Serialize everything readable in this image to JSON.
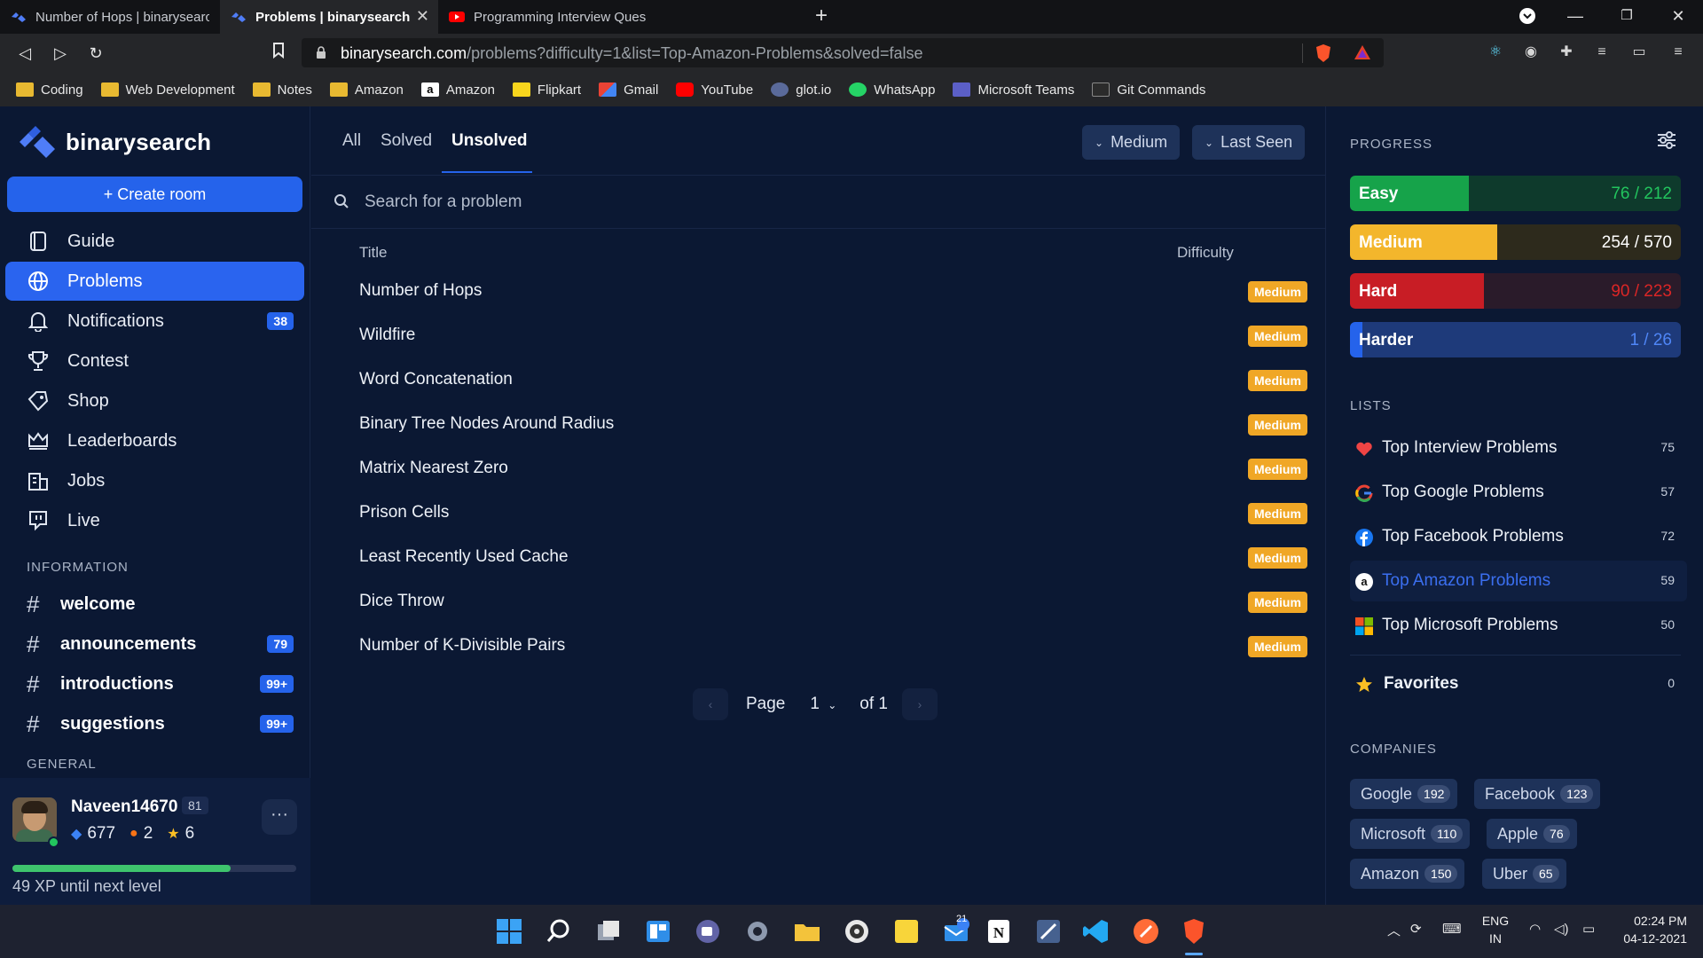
{
  "browser": {
    "tabs": [
      {
        "label": "Number of Hops | binarysearch",
        "active": false
      },
      {
        "label": "Problems | binarysearch",
        "active": true
      },
      {
        "label": "Programming Interview Question: Min",
        "active": false
      }
    ],
    "new_tab_label": "+",
    "url_domain": "binarysearch.com",
    "url_path": "/problems?difficulty=1&list=Top-Amazon-Problems&solved=false",
    "bookmarks": [
      {
        "label": "Coding",
        "icon": "folder-icon"
      },
      {
        "label": "Web Development",
        "icon": "folder-icon"
      },
      {
        "label": "Notes",
        "icon": "folder-icon"
      },
      {
        "label": "Amazon",
        "icon": "folder-icon"
      },
      {
        "label": "Amazon",
        "icon": "amazon-icon"
      },
      {
        "label": "Flipkart",
        "icon": "flipkart-icon"
      },
      {
        "label": "Gmail",
        "icon": "gmail-icon"
      },
      {
        "label": "YouTube",
        "icon": "youtube-icon"
      },
      {
        "label": "glot.io",
        "icon": "glot-icon"
      },
      {
        "label": "WhatsApp",
        "icon": "whatsapp-icon"
      },
      {
        "label": "Microsoft Teams",
        "icon": "teams-icon"
      },
      {
        "label": "Git Commands",
        "icon": "git-icon"
      }
    ]
  },
  "sidebar": {
    "logo_text": "binarysearch",
    "create_room": "+ Create room",
    "nav": [
      {
        "label": "Guide",
        "icon": "book-icon",
        "badge": ""
      },
      {
        "label": "Problems",
        "icon": "globe-icon",
        "badge": "",
        "active": true
      },
      {
        "label": "Notifications",
        "icon": "bell-icon",
        "badge": "38"
      },
      {
        "label": "Contest",
        "icon": "trophy-icon",
        "badge": ""
      },
      {
        "label": "Shop",
        "icon": "tag-icon",
        "badge": ""
      },
      {
        "label": "Leaderboards",
        "icon": "crown-icon",
        "badge": ""
      },
      {
        "label": "Jobs",
        "icon": "building-icon",
        "badge": ""
      },
      {
        "label": "Live",
        "icon": "live-icon",
        "badge": ""
      }
    ],
    "information_title": "INFORMATION",
    "channels": [
      {
        "label": "welcome",
        "badge": ""
      },
      {
        "label": "announcements",
        "badge": "79"
      },
      {
        "label": "introductions",
        "badge": "99+"
      },
      {
        "label": "suggestions",
        "badge": "99+"
      }
    ],
    "general_title": "GENERAL",
    "user": {
      "name": "Naveen14670",
      "level": "81",
      "gems": "677",
      "streak": "2",
      "stars": "6",
      "more": "···",
      "xp_fraction": 0.77,
      "xp_text": "49 XP until next level"
    }
  },
  "main": {
    "filter_tabs": [
      "All",
      "Solved",
      "Unsolved"
    ],
    "active_filter": "Unsolved",
    "difficulty_dropdown": "Medium",
    "sort_dropdown": "Last Seen",
    "search_placeholder": "Search for a problem",
    "columns": {
      "title": "Title",
      "difficulty": "Difficulty"
    },
    "problems": [
      {
        "title": "Number of Hops",
        "difficulty": "Medium"
      },
      {
        "title": "Wildfire",
        "difficulty": "Medium"
      },
      {
        "title": "Word Concatenation",
        "difficulty": "Medium"
      },
      {
        "title": "Binary Tree Nodes Around Radius",
        "difficulty": "Medium"
      },
      {
        "title": "Matrix Nearest Zero",
        "difficulty": "Medium"
      },
      {
        "title": "Prison Cells",
        "difficulty": "Medium"
      },
      {
        "title": "Least Recently Used Cache",
        "difficulty": "Medium"
      },
      {
        "title": "Dice Throw",
        "difficulty": "Medium"
      },
      {
        "title": "Number of K-Divisible Pairs",
        "difficulty": "Medium"
      }
    ],
    "pager": {
      "page_label": "Page",
      "page": "1",
      "of_label": "of 1"
    }
  },
  "right": {
    "progress_title": "PROGRESS",
    "progress": [
      {
        "label": "Easy",
        "value": "76 / 212",
        "solved": 76,
        "total": 212,
        "fill": "#16a34a",
        "track": "#0e3a2c",
        "valcolor": "#22c55e"
      },
      {
        "label": "Medium",
        "value": "254 / 570",
        "solved": 254,
        "total": 570,
        "fill": "#f3b62c",
        "track": "#2d2a1c",
        "valcolor": "#ffffff"
      },
      {
        "label": "Hard",
        "value": "90 / 223",
        "solved": 90,
        "total": 223,
        "fill": "#c81d25",
        "track": "#2a1b2a",
        "valcolor": "#dc2626"
      },
      {
        "label": "Harder",
        "value": "1 / 26",
        "solved": 1,
        "total": 26,
        "fill": "#2563eb",
        "track": "#1e3a7a",
        "valcolor": "#4f86f7"
      }
    ],
    "lists_title": "LISTS",
    "lists": [
      {
        "label": "Top Interview Problems",
        "count": "75",
        "icon": "heart-icon"
      },
      {
        "label": "Top Google Problems",
        "count": "57",
        "icon": "google-icon"
      },
      {
        "label": "Top Facebook Problems",
        "count": "72",
        "icon": "facebook-icon"
      },
      {
        "label": "Top Amazon Problems",
        "count": "59",
        "icon": "amazon-icon",
        "active": true
      },
      {
        "label": "Top Microsoft Problems",
        "count": "50",
        "icon": "microsoft-icon"
      }
    ],
    "favorites": {
      "label": "Favorites",
      "count": "0",
      "icon": "star-icon"
    },
    "companies_title": "COMPANIES",
    "companies": [
      {
        "name": "Google",
        "count": "192"
      },
      {
        "name": "Facebook",
        "count": "123"
      },
      {
        "name": "Microsoft",
        "count": "110"
      },
      {
        "name": "Apple",
        "count": "76"
      },
      {
        "name": "Amazon",
        "count": "150"
      },
      {
        "name": "Uber",
        "count": "65"
      }
    ]
  },
  "taskbar": {
    "lang_top": "ENG",
    "lang_bottom": "IN",
    "time": "02:24 PM",
    "date": "04-12-2021",
    "mail_badge": "21"
  }
}
